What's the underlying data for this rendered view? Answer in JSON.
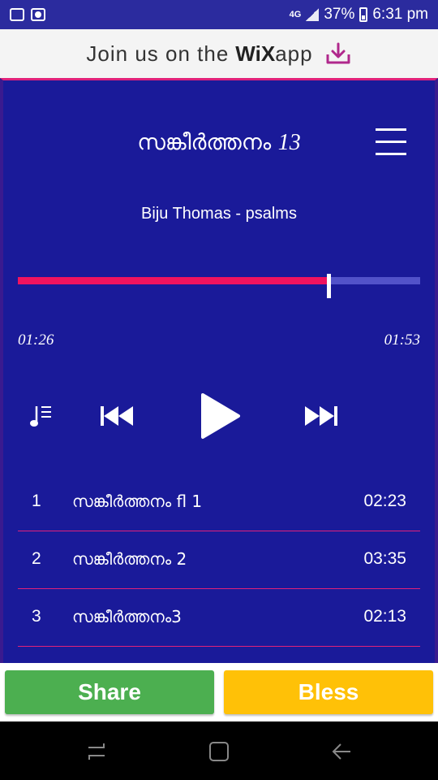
{
  "status_bar": {
    "network": "4G",
    "battery": "37%",
    "time": "6:31 pm"
  },
  "banner": {
    "text": "Join us on the",
    "brand": "WiX",
    "app": "app"
  },
  "player": {
    "title": "സങ്കീർത്തനം",
    "title_number": "13",
    "artist": "Biju Thomas - psalms",
    "elapsed": "01:26",
    "duration": "01:53",
    "progress": 0.772
  },
  "tracks": [
    {
      "number": "1",
      "title": "സങ്കീർത്തനം fl 1",
      "duration": "02:23"
    },
    {
      "number": "2",
      "title": "സങ്കീർത്തനം 2",
      "duration": "03:35"
    },
    {
      "number": "3",
      "title": "സങ്കീർത്തനം3",
      "duration": "02:13"
    }
  ],
  "actions": {
    "share": "Share",
    "bless": "Bless"
  },
  "colors": {
    "background": "#1a1a99",
    "accent": "#f0135f",
    "share": "#4caf50",
    "bless": "#ffc107"
  }
}
